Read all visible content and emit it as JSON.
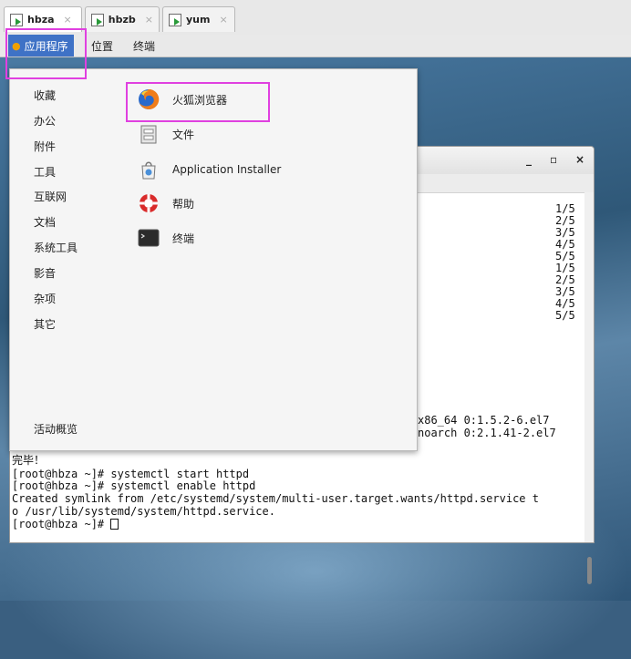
{
  "vm_tabs": [
    {
      "label": "hbza",
      "close": "×",
      "active": true
    },
    {
      "label": "hbzb",
      "close": "×",
      "active": false
    },
    {
      "label": "yum",
      "close": "×",
      "active": false
    }
  ],
  "panel": {
    "applications": "应用程序",
    "places": "位置",
    "terminal": "终端"
  },
  "menu": {
    "categories": [
      "收藏",
      "办公",
      "附件",
      "工具",
      "互联网",
      "文档",
      "系统工具",
      "影音",
      "杂项",
      "其它"
    ],
    "activities": "活动概览",
    "apps": [
      {
        "label": "火狐浏览器",
        "icon": "firefox-icon"
      },
      {
        "label": "文件",
        "icon": "files-icon"
      },
      {
        "label": "Application Installer",
        "icon": "installer-icon"
      },
      {
        "label": "帮助",
        "icon": "help-icon"
      },
      {
        "label": "终端",
        "icon": "terminal-icon"
      }
    ]
  },
  "terminal": {
    "window_buttons": {
      "minimize": "_",
      "maximize": "▫",
      "close": "×"
    },
    "progress": [
      "1/5",
      "2/5",
      "3/5",
      "4/5",
      "5/5",
      "1/5",
      "2/5",
      "3/5",
      "4/5",
      "5/5"
    ],
    "pkg_lines": [
      "x86_64 0:1.5.2-6.el7",
      "noarch 0:2.1.41-2.el7"
    ],
    "lines": [
      "完毕！",
      "[root@hbza ~]# systemctl start httpd",
      "[root@hbza ~]# systemctl enable httpd",
      "Created symlink from /etc/systemd/system/multi-user.target.wants/httpd.service t",
      "o /usr/lib/systemd/system/httpd.service.",
      "[root@hbza ~]# "
    ]
  },
  "colors": {
    "accent": "#3f72c6",
    "highlight": "#e040e0"
  }
}
